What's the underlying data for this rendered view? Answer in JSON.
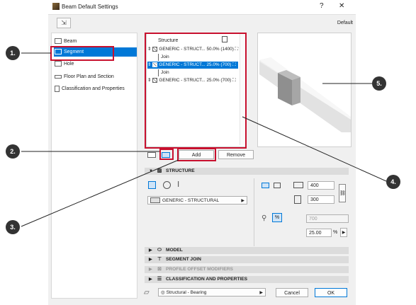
{
  "window": {
    "title": "Beam Default Settings",
    "help_glyph": "?",
    "close_glyph": "✕",
    "default_label": "Default"
  },
  "tree": {
    "items": [
      {
        "label": "Beam",
        "selected": false
      },
      {
        "label": "Segment",
        "selected": true
      },
      {
        "label": "Hole",
        "selected": false
      },
      {
        "label": "Floor Plan and Section",
        "selected": false
      },
      {
        "label": "Classification and Properties",
        "selected": false
      }
    ]
  },
  "structure_list": {
    "header": "Structure",
    "rows": [
      {
        "type": "segment",
        "name": "GENERIC - STRUCT...",
        "value": "50.0% (1400)",
        "selected": false
      },
      {
        "type": "join",
        "name": "Join"
      },
      {
        "type": "segment",
        "name": "GENERIC - STRUCT...",
        "value": "25.0% (700)",
        "selected": true
      },
      {
        "type": "join",
        "name": "Join"
      },
      {
        "type": "segment",
        "name": "GENERIC - STRUCT...",
        "value": "25.0% (700)",
        "selected": false
      }
    ]
  },
  "buttons": {
    "add": "Add",
    "remove": "Remove",
    "cancel": "Cancel",
    "ok": "OK"
  },
  "sections": {
    "structure": "STRUCTURE",
    "model": "MODEL",
    "segment_join": "SEGMENT JOIN",
    "profile_offset": "PROFILE OFFSET MODIFIERS",
    "classification": "CLASSIFICATION AND PROPERTIES"
  },
  "structure_panel": {
    "material": "GENERIC - STRUCTURAL",
    "width": "400",
    "height": "300",
    "length_disabled": "700",
    "percent_value": "25.00",
    "percent_unit": "%"
  },
  "footer": {
    "layer": "Structural - Bearing"
  },
  "callouts": [
    "1.",
    "2.",
    "3.",
    "4.",
    "5."
  ],
  "colors": {
    "accent": "#0078d7",
    "highlight": "#c8102e",
    "callout": "#333333"
  }
}
